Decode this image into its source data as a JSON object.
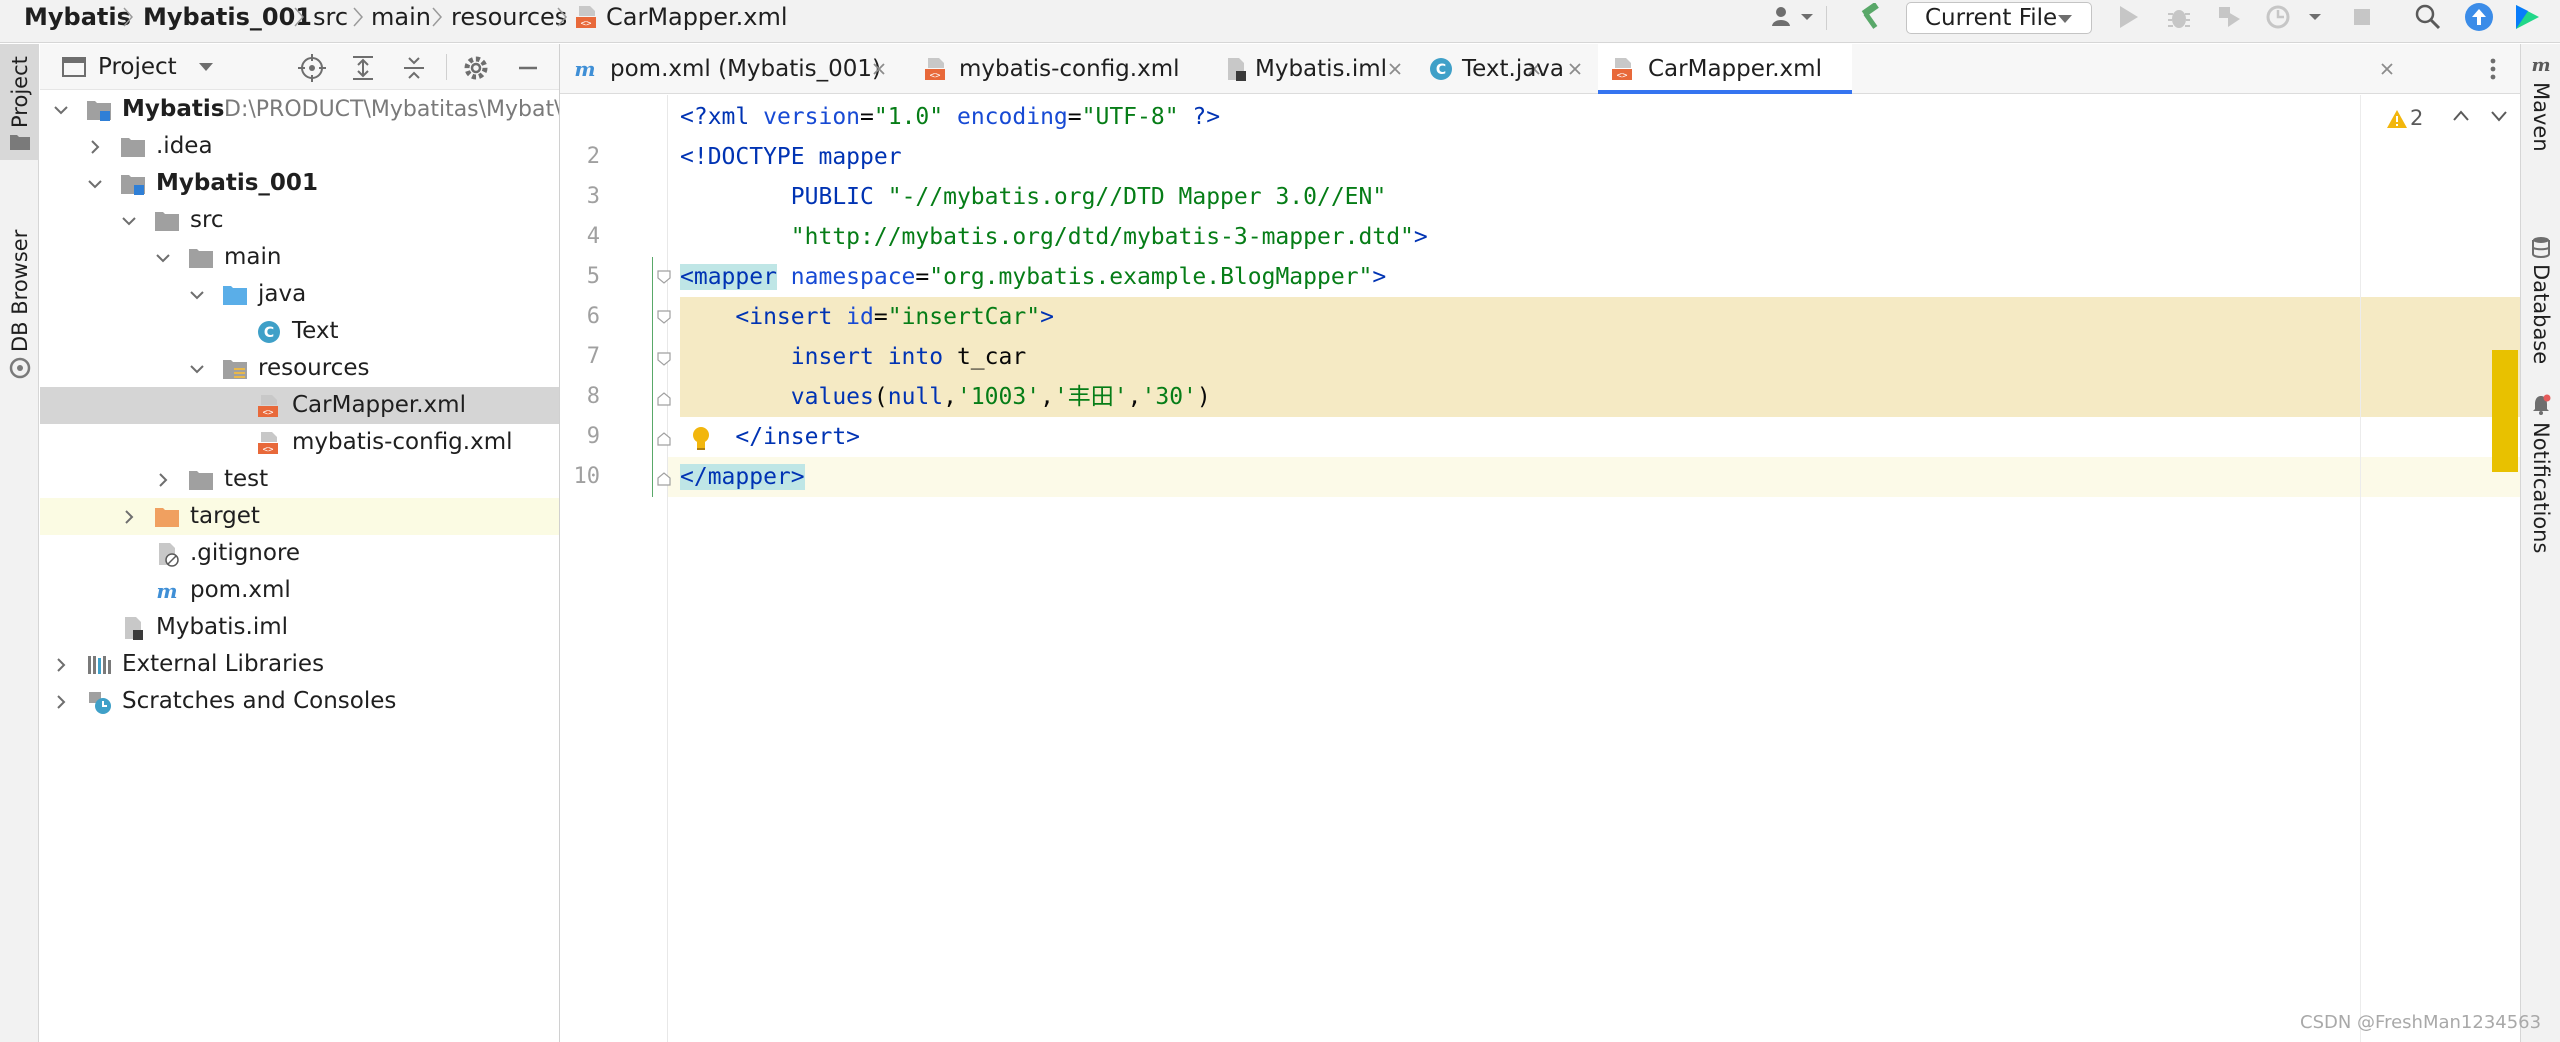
{
  "breadcrumb": {
    "items": [
      "Mybatis",
      "Mybatis_001",
      "src",
      "main",
      "resources",
      "CarMapper.xml"
    ]
  },
  "toolbar": {
    "run_config": "Current File"
  },
  "left_stripe": {
    "project": "Project",
    "db_browser": "DB Browser"
  },
  "right_stripe": {
    "maven": "Maven",
    "database": "Database",
    "notifications": "Notifications"
  },
  "project_panel": {
    "title": "Project",
    "tree": [
      {
        "label": "Mybatis",
        "path": "D:\\PRODUCT\\Mybatitas\\Mybat\\Mybatis",
        "icon": "module-folder-icon"
      },
      {
        "label": ".idea",
        "icon": "folder-icon"
      },
      {
        "label": "Mybatis_001",
        "icon": "module-folder-icon"
      },
      {
        "label": "src",
        "icon": "folder-icon"
      },
      {
        "label": "main",
        "icon": "folder-icon"
      },
      {
        "label": "java",
        "icon": "source-folder-icon"
      },
      {
        "label": "Text",
        "icon": "java-class-icon"
      },
      {
        "label": "resources",
        "icon": "resources-folder-icon"
      },
      {
        "label": "CarMapper.xml",
        "icon": "xml-file-icon"
      },
      {
        "label": "mybatis-config.xml",
        "icon": "xml-file-icon"
      },
      {
        "label": "test",
        "icon": "folder-icon"
      },
      {
        "label": "target",
        "icon": "excluded-folder-icon"
      },
      {
        "label": ".gitignore",
        "icon": "gitignore-file-icon"
      },
      {
        "label": "pom.xml",
        "icon": "maven-file-icon"
      },
      {
        "label": "Mybatis.iml",
        "icon": "iml-file-icon"
      },
      {
        "label": "External Libraries",
        "icon": "libraries-icon"
      },
      {
        "label": "Scratches and Consoles",
        "icon": "scratches-icon"
      }
    ]
  },
  "tabs": [
    {
      "label": "pom.xml (Mybatis_001)",
      "icon": "maven-file-icon"
    },
    {
      "label": "mybatis-config.xml",
      "icon": "xml-file-icon"
    },
    {
      "label": "Mybatis.iml",
      "icon": "iml-file-icon"
    },
    {
      "label": "Text.java",
      "icon": "java-class-icon"
    },
    {
      "label": "CarMapper.xml",
      "icon": "xml-file-icon",
      "active": true
    }
  ],
  "editor": {
    "warning_count": "2",
    "line_numbers": [
      "2",
      "3",
      "4",
      "5",
      "6",
      "7",
      "8",
      "9",
      "10"
    ],
    "lines": {
      "l1_a": "<?",
      "l1_b": "xml ",
      "l1_c": "version",
      "l1_d": "=",
      "l1_e": "\"1.0\"",
      "l1_f": " encoding",
      "l1_g": "=",
      "l1_h": "\"UTF-8\"",
      "l1_i": " ?>",
      "l2": "<!DOCTYPE mapper",
      "l3_a": "        PUBLIC ",
      "l3_b": "\"-//mybatis.org//DTD Mapper 3.0//EN\"",
      "l4_a": "        ",
      "l4_b": "\"http://mybatis.org/dtd/mybatis-3-mapper.dtd\"",
      "l4_c": ">",
      "l5_a": "<mapper",
      "l5_b": " namespace",
      "l5_c": "=",
      "l5_d": "\"org.mybatis.example.BlogMapper\"",
      "l5_e": ">",
      "l6_a": "    <insert",
      "l6_b": " id",
      "l6_c": "=",
      "l6_d": "\"insertCar\"",
      "l6_e": ">",
      "l7_a": "        insert into ",
      "l7_b": "t_car",
      "l8_a": "        values",
      "l8_b": "(",
      "l8_c": "null",
      "l8_d": ",",
      "l8_e": "'1003'",
      "l8_f": ",",
      "l8_g": "'丰田'",
      "l8_h": ",",
      "l8_i": "'30'",
      "l8_j": ")",
      "l9_a": "    </insert",
      "l9_b": ">",
      "l10_a": "</mapper",
      "l10_b": ">"
    }
  },
  "watermark": "CSDN @FreshMan1234563",
  "colors": {
    "accent": "#3574f0",
    "highlight": "#f5eac4",
    "warning": "#e8c100"
  }
}
